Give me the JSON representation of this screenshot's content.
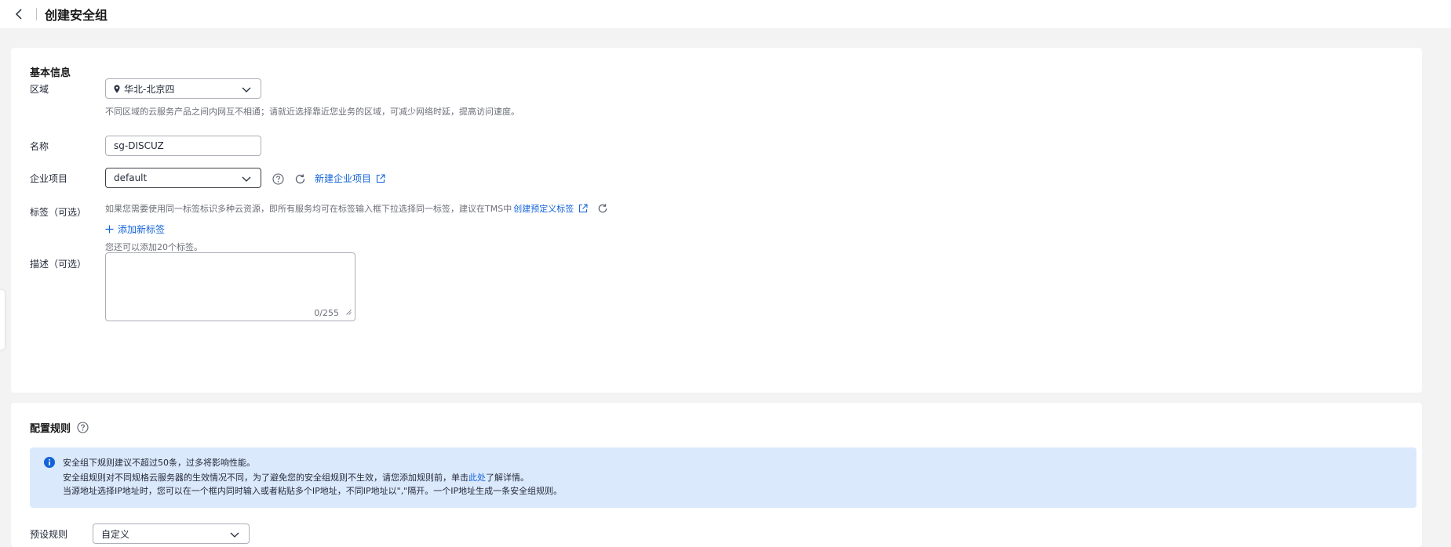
{
  "header": {
    "title": "创建安全组"
  },
  "basic": {
    "section_title": "基本信息",
    "region": {
      "label": "区域",
      "value": "华北-北京四",
      "hint": "不同区域的云服务产品之间内网互不相通；请就近选择靠近您业务的区域，可减少网络时延，提高访问速度。"
    },
    "name": {
      "label": "名称",
      "value": "sg-DISCUZ"
    },
    "project": {
      "label": "企业项目",
      "value": "default",
      "new_link": "新建企业项目"
    },
    "tags": {
      "label": "标签（可选）",
      "hint": "如果您需要使用同一标签标识多种云资源，即所有服务均可在标签输入框下拉选择同一标签，建议在TMS中",
      "create_link": "创建预定义标签",
      "add_label": "添加新标签",
      "remaining": "您还可以添加20个标签。"
    },
    "description": {
      "label": "描述（可选）",
      "value": "",
      "counter": "0/255"
    }
  },
  "rules": {
    "section_title": "配置规则",
    "notice": {
      "line1": "安全组下规则建议不超过50条，过多将影响性能。",
      "line2_pre": "安全组规则对不同规格云服务器的生效情况不同，为了避免您的安全组规则不生效，请您添加规则前，单击",
      "line2_link": "此处",
      "line2_post": "了解详情。",
      "line3": "当源地址选择IP地址时，您可以在一个框内同时输入或者粘贴多个IP地址，不同IP地址以\",\"隔开。一个IP地址生成一条安全组规则。"
    },
    "preset": {
      "label": "预设规则",
      "value": "自定义"
    }
  },
  "colors": {
    "link": "#1363d8",
    "notice_bg": "#dbe9fd",
    "info_icon": "#1363d8"
  }
}
